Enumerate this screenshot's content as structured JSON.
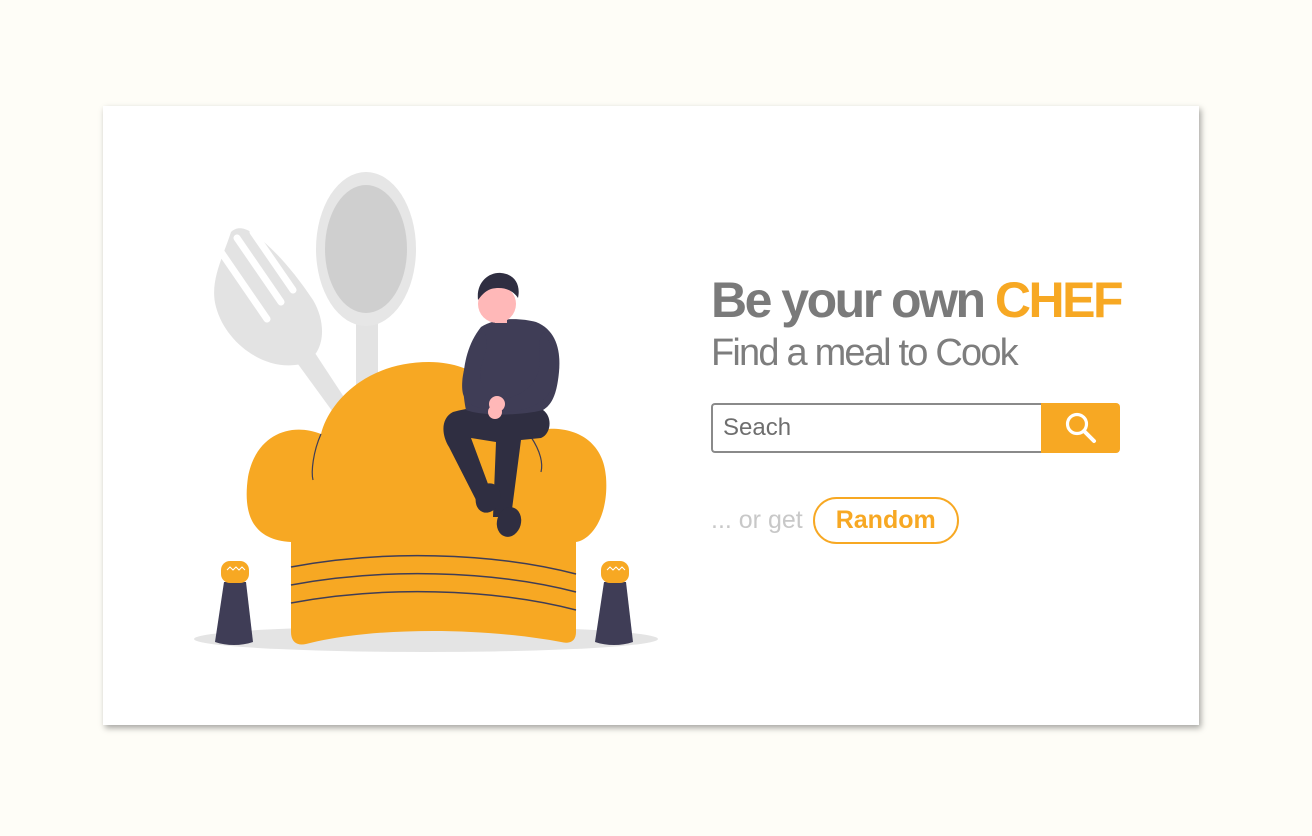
{
  "hero": {
    "title_prefix": "Be your own ",
    "title_accent": "CHEF",
    "subtitle": "Find a meal to Cook"
  },
  "search": {
    "placeholder": "Seach",
    "value": "",
    "button_icon": "search-icon"
  },
  "random": {
    "prefix": "... or get",
    "button_label": "Random"
  },
  "colors": {
    "accent": "#f7a823",
    "heading": "#7a7a7a",
    "muted": "#c8c8c8",
    "page_background": "#fefdf7",
    "card_background": "#ffffff"
  },
  "illustration": {
    "icons": [
      "fork-icon",
      "spoon-icon",
      "chef-hat-icon",
      "person-icon",
      "salt-shaker-icon",
      "pepper-shaker-icon"
    ]
  }
}
